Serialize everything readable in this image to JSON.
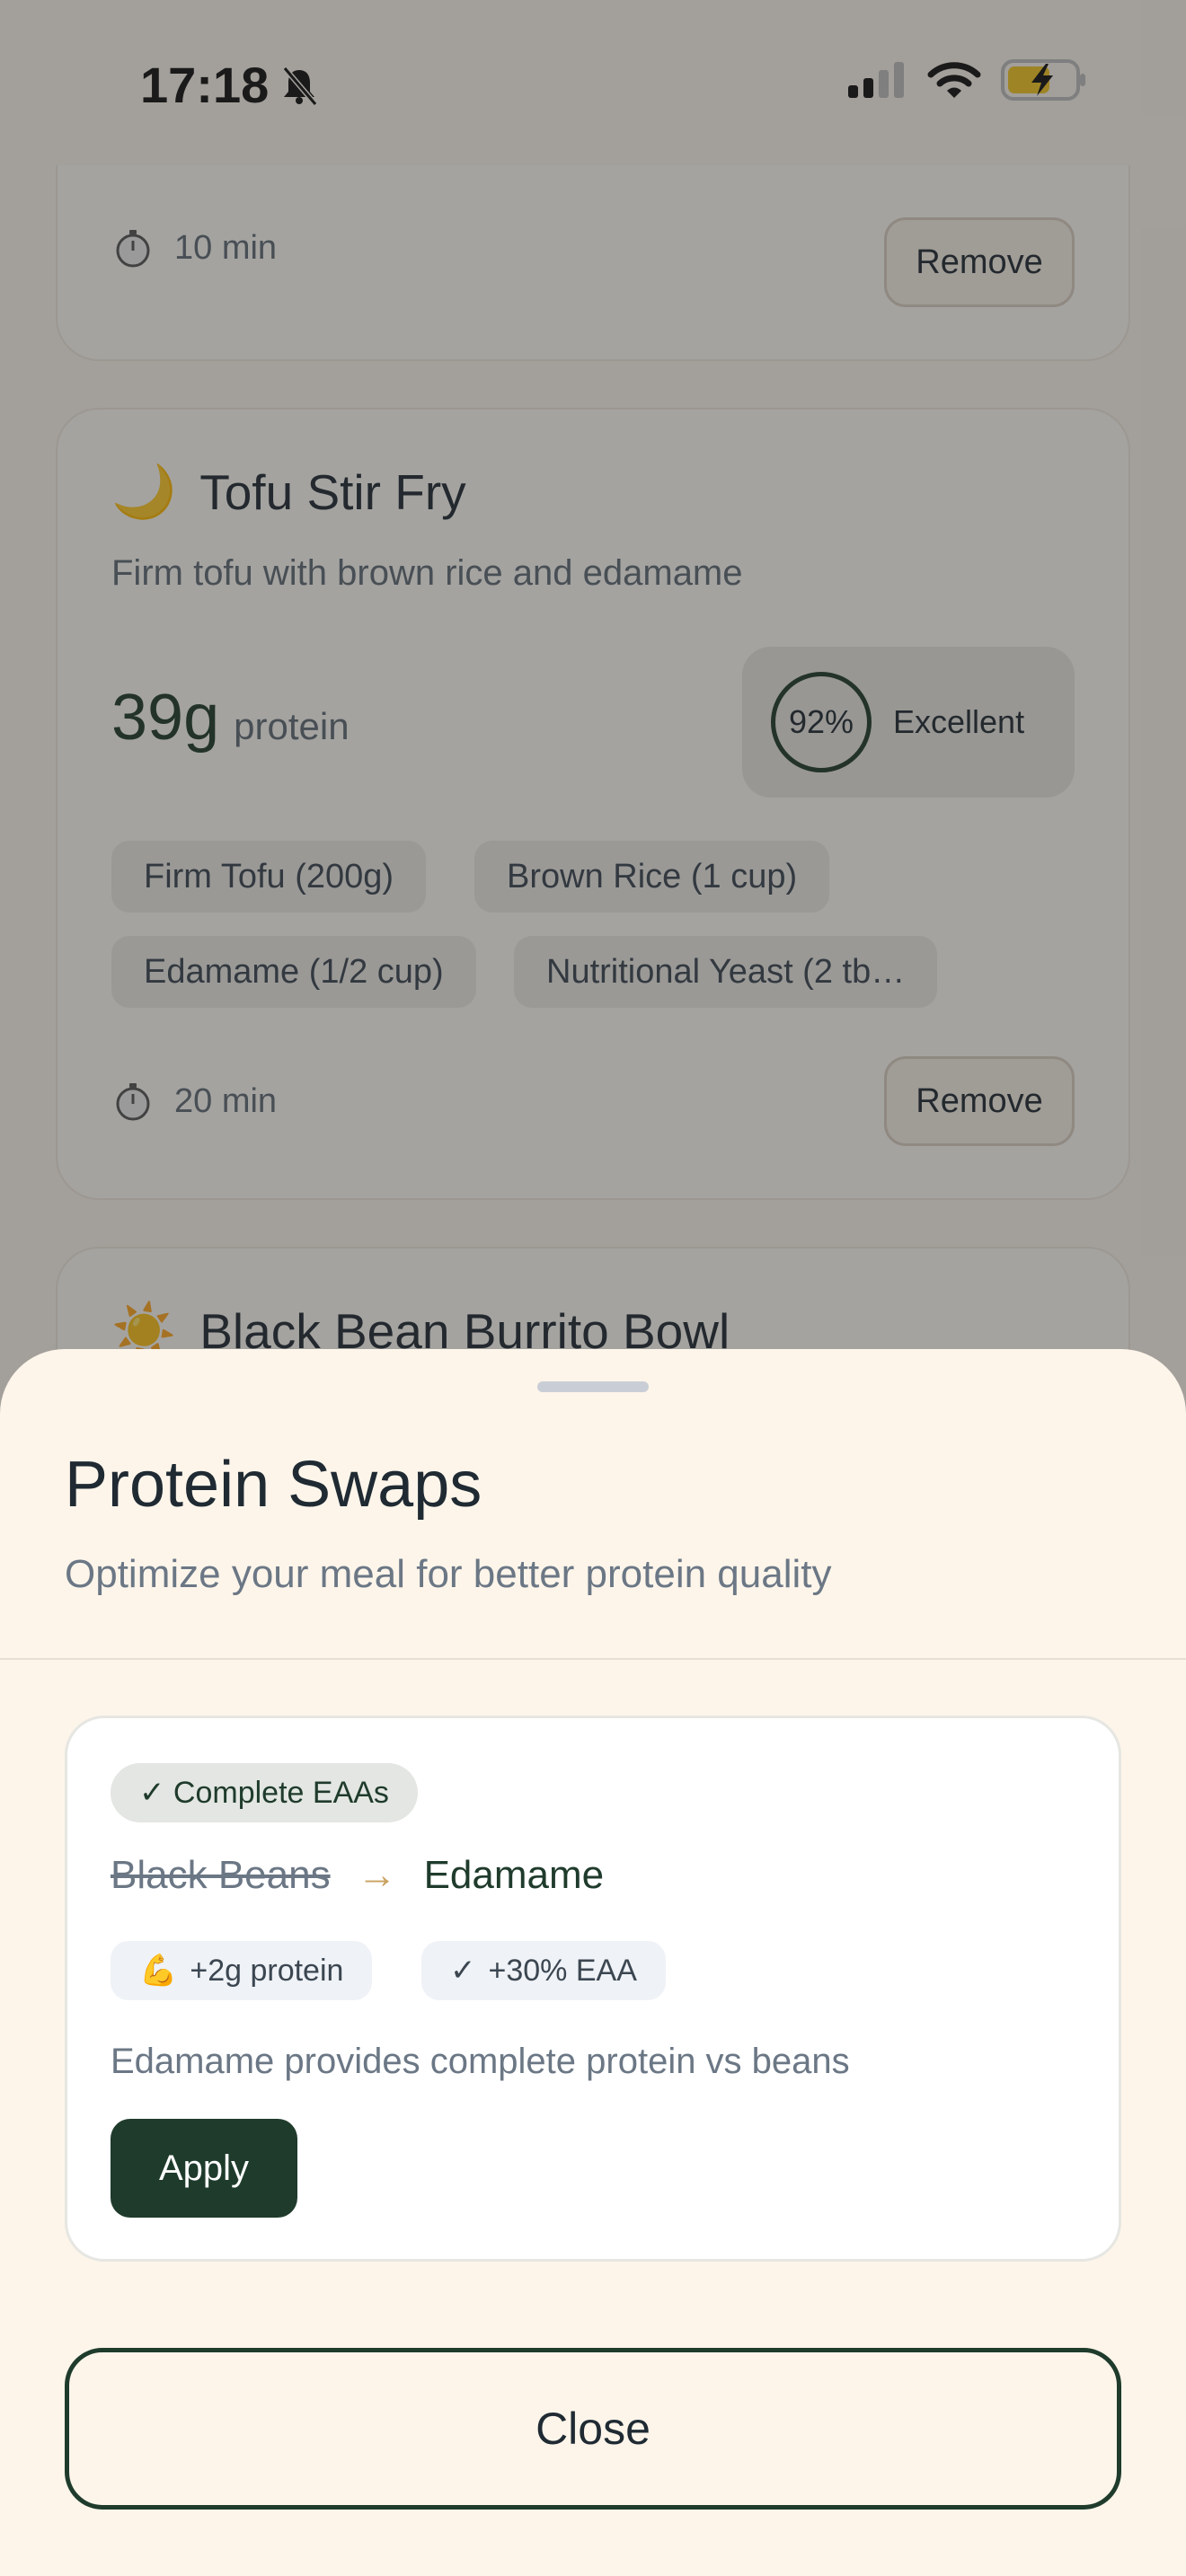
{
  "status_bar": {
    "time": "17:18",
    "icons": [
      "bell-slash-icon",
      "signal-icon",
      "wifi-icon",
      "battery-charging-icon"
    ]
  },
  "meals": {
    "top_card": {
      "time": "10 min",
      "remove_label": "Remove"
    },
    "tofu": {
      "emoji": "🌙",
      "name": "Tofu Stir Fry",
      "description": "Firm tofu with brown rice and edamame",
      "protein_value": "39g",
      "protein_unit": "protein",
      "score": "92%",
      "score_label": "Excellent",
      "ingredients": [
        "Firm Tofu (200g)",
        "Brown Rice (1 cup)",
        "Edamame (1/2 cup)",
        "Nutritional Yeast (2 tb…"
      ],
      "time": "20 min",
      "remove_label": "Remove"
    },
    "burrito": {
      "emoji": "☀️",
      "name": "Black Bean Burrito Bowl"
    }
  },
  "sheet": {
    "title": "Protein Swaps",
    "subtitle": "Optimize your meal for better protein quality",
    "swap": {
      "badge": "✓ Complete EAAs",
      "from": "Black Beans",
      "arrow": "→",
      "to": "Edamame",
      "benefits": [
        {
          "icon": "💪",
          "label": "+2g protein"
        },
        {
          "icon": "✓",
          "label": "+30% EAA"
        }
      ],
      "note": "Edamame provides complete protein vs beans",
      "apply_label": "Apply"
    },
    "close_label": "Close"
  },
  "colors": {
    "accent": "#1f3b2c",
    "sheet_bg": "#fdf5ea",
    "arrow": "#c9a25f"
  }
}
